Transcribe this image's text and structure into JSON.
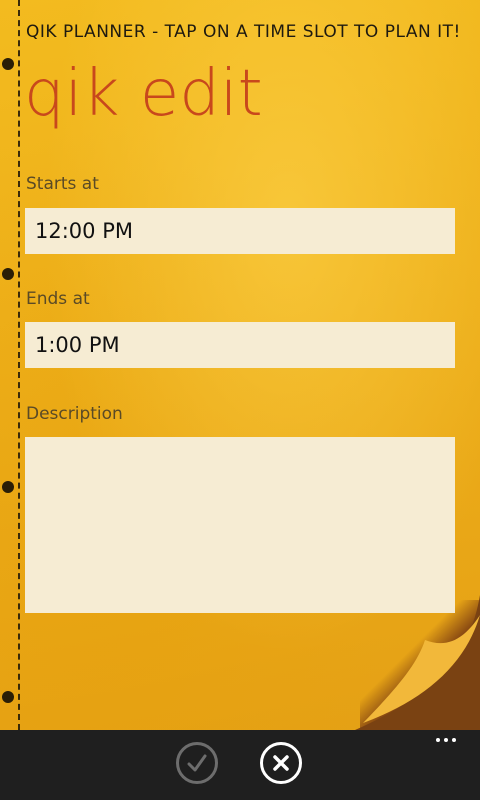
{
  "app": {
    "title": "QIK PLANNER - TAP ON A TIME SLOT TO PLAN IT!",
    "page_title": "qik edit"
  },
  "form": {
    "starts_label": "Starts at",
    "starts_value": "12:00 PM",
    "ends_label": "Ends at",
    "ends_value": "1:00 PM",
    "description_label": "Description",
    "description_value": ""
  },
  "appbar": {
    "buttons": [
      {
        "icon": "check-icon",
        "enabled": false
      },
      {
        "icon": "close-icon",
        "enabled": true
      }
    ],
    "more_icon": "ellipsis-icon"
  },
  "colors": {
    "paper": "#eeb01a",
    "title_accent": "#c8481c",
    "field_bg": "#f6ecd3",
    "appbar_bg": "#1f1f1f"
  }
}
